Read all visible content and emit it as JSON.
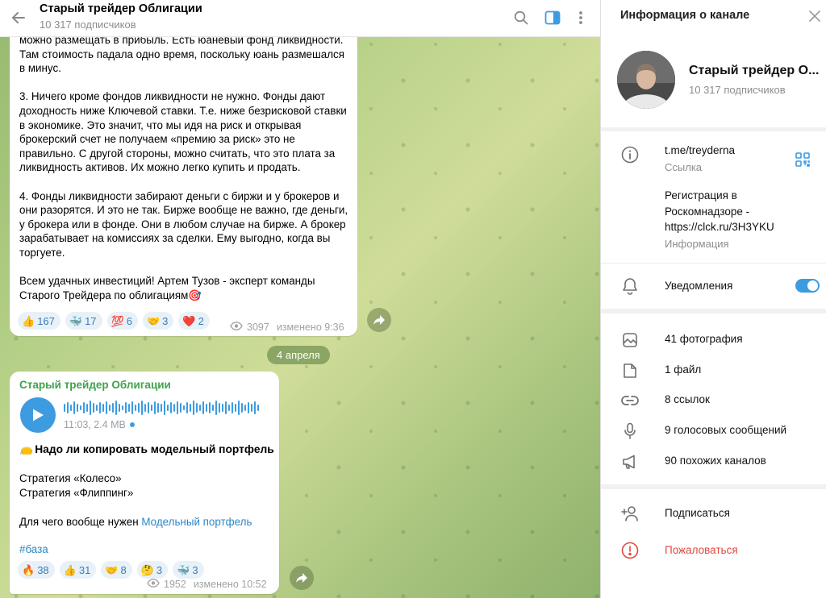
{
  "chat": {
    "title": "Старый трейдер Облигации",
    "subscribers": "10 317 подписчиков",
    "message1": {
      "text": "можно размещать в прибыль. Есть юаневый фонд ликвидности. Там стоимость падала одно время, поскольку юань размешался в минус.\n\n3. Ничего кроме фондов ликвидности не нужно. Фонды дают доходность ниже Ключевой ставки. Т.е. ниже безрисковой ставки в экономике. Это значит, что мы идя на риск и открывая брокерский счет не получаем «премию за риск» это не правильно. С другой стороны, можно считать, что это плата за ликвидность активов. Их можно легко купить и продать.\n\n4. Фонды ликвидности забирают деньги с биржи и у брокеров и они  разорятся. И это не так. Бирже вообще не важно, где деньги, у брокера или в фонде. Они в любом случае на бирже. А брокер зарабатывает на комиссиях за сделки. Ему выгодно, когда вы торгуете.\n\nВсем удачных инвестиций! Артем Тузов - эксперт команды Старого Трейдера по облигациям🎯",
      "reactions": [
        {
          "emoji": "👍",
          "count": "167"
        },
        {
          "emoji": "🐳",
          "count": "17"
        },
        {
          "emoji": "💯",
          "count": "6"
        },
        {
          "emoji": "🤝",
          "count": "3"
        },
        {
          "emoji": "❤️",
          "count": "2"
        }
      ],
      "views": "3097",
      "edited": "изменено 9:36"
    },
    "date_separator": "4 апреля",
    "message2": {
      "author": "Старый трейдер Облигации",
      "voice_meta": "11:03, 2.4 MB",
      "headline_emoji": "👝",
      "headline": "Надо ли копировать модельный портфель",
      "line1": "Стратегия «Колесо»",
      "line2": "Стратегия «Флиппинг»",
      "line3_prefix": "Для чего вообще нужен ",
      "line3_link": "Модельный портфель",
      "hashtag": "#база",
      "reactions": [
        {
          "emoji": "🔥",
          "count": "38"
        },
        {
          "emoji": "👍",
          "count": "31"
        },
        {
          "emoji": "🤝",
          "count": "8"
        },
        {
          "emoji": "🤔",
          "count": "3"
        },
        {
          "emoji": "🐳",
          "count": "3"
        }
      ],
      "views": "1952",
      "edited": "изменено 10:52"
    }
  },
  "panel": {
    "title": "Информация о канале",
    "name": "Старый трейдер О...",
    "subscribers": "10 317 подписчиков",
    "link": "t.me/treyderna",
    "link_label": "Ссылка",
    "info_line1": "Регистрация в",
    "info_line2": "Роскомнадзоре -",
    "info_link": "https://clck.ru/3H3YKU",
    "info_label": "Информация",
    "notifications": "Уведомления",
    "notifications_on": true,
    "media": [
      {
        "icon": "photo-icon",
        "label": "41 фотография"
      },
      {
        "icon": "file-icon",
        "label": "1 файл"
      },
      {
        "icon": "link-icon",
        "label": "8 ссылок"
      },
      {
        "icon": "microphone-icon",
        "label": "9 голосовых сообщений"
      },
      {
        "icon": "megaphone-icon",
        "label": "90 похожих каналов"
      }
    ],
    "subscribe": "Подписаться",
    "report": "Пожаловаться"
  },
  "colors": {
    "accent": "#3d9be0",
    "author": "#3fa34d",
    "danger": "#e0483f",
    "reaction_bg": "#e8f1f8"
  }
}
